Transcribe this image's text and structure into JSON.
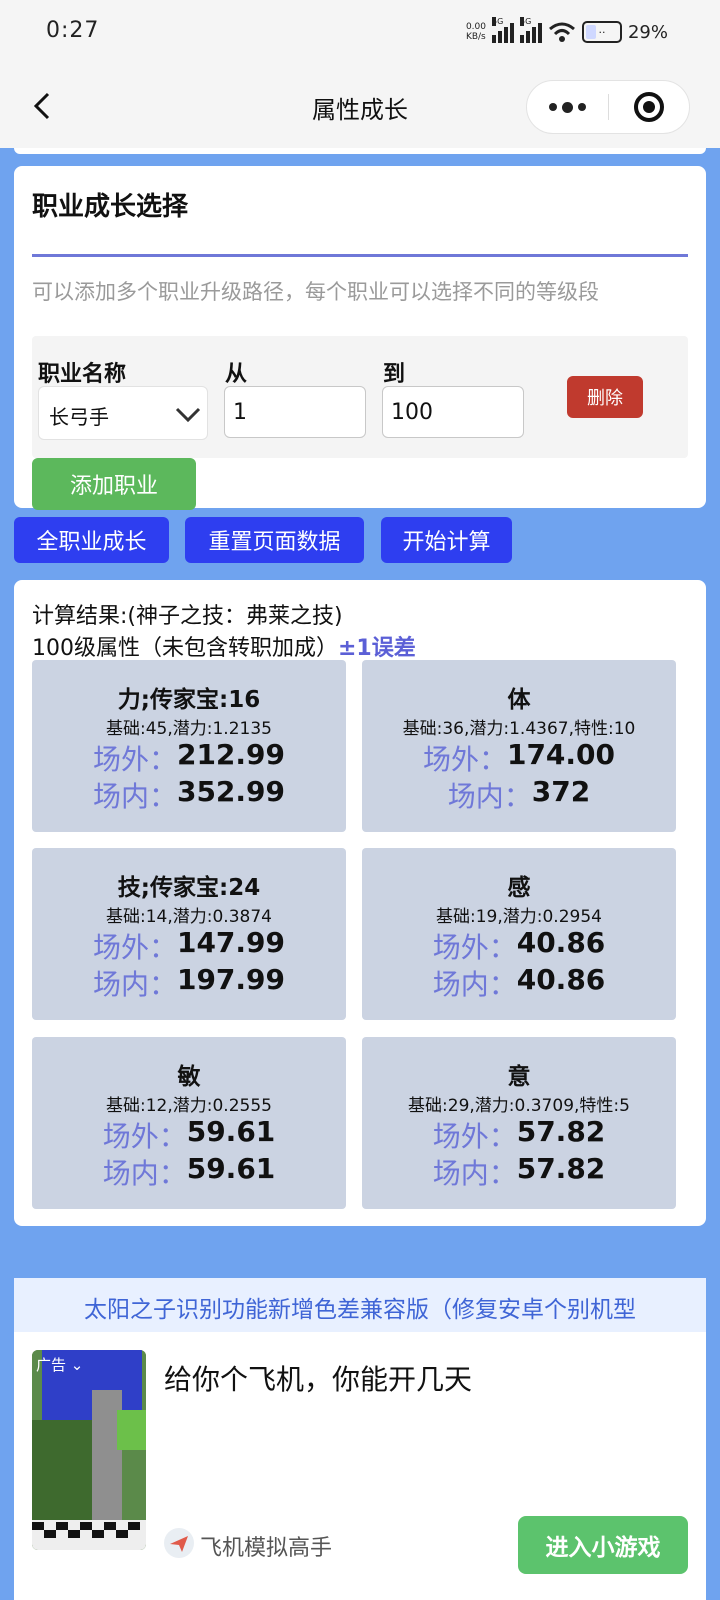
{
  "status": {
    "time": "0:27",
    "net_speed_value": "0.00",
    "net_speed_unit": "KB/s",
    "signal_label_1": "5G",
    "signal_label_2": "5G",
    "battery": "29%"
  },
  "nav": {
    "title": "属性成长"
  },
  "career_card": {
    "title": "职业成长选择",
    "description": "可以添加多个职业升级路径，每个职业可以选择不同的等级段",
    "path_row": {
      "job_label": "职业名称",
      "job_value": "长弓手",
      "from_label": "从",
      "from_value": "1",
      "to_label": "到",
      "to_value": "100",
      "delete_label": "删除"
    },
    "add_label": "添加职业"
  },
  "actions": {
    "all_growth": "全职业成长",
    "reset": "重置页面数据",
    "calculate": "开始计算"
  },
  "results": {
    "line1": "计算结果:(神子之技：弗莱之技)",
    "line2": "100级属性（未包含转职加成）",
    "line2_note": "±1误差",
    "outside_label": "场外：",
    "inside_label": "场内：",
    "stats": [
      {
        "name": "力;传家宝:16",
        "base": "基础:45,潜力:1.2135",
        "outside": "212.99",
        "inside": "352.99"
      },
      {
        "name": "体",
        "base": "基础:36,潜力:1.4367,特性:10",
        "outside": "174.00",
        "inside": "372"
      },
      {
        "name": "技;传家宝:24",
        "base": "基础:14,潜力:0.3874",
        "outside": "147.99",
        "inside": "197.99"
      },
      {
        "name": "感",
        "base": "基础:19,潜力:0.2954",
        "outside": "40.86",
        "inside": "40.86"
      },
      {
        "name": "敏",
        "base": "基础:12,潜力:0.2555",
        "outside": "59.61",
        "inside": "59.61"
      },
      {
        "name": "意",
        "base": "基础:29,潜力:0.3709,特性:5",
        "outside": "57.82",
        "inside": "57.82"
      }
    ]
  },
  "ad": {
    "marquee": "太阳之子识别功能新增色差兼容版（修复安卓个别机型",
    "tag": "广告",
    "title": "给你个飞机，你能开几天",
    "brand": "飞机模拟高手",
    "cta": "进入小游戏"
  },
  "colors": {
    "page_bg": "#6fa3ef",
    "primary_button": "#2e3ef0",
    "success_button": "#5cb85c",
    "danger_button": "#c03a2e",
    "stat_card": "#cbd3e2",
    "accent": "#6f78d8"
  }
}
